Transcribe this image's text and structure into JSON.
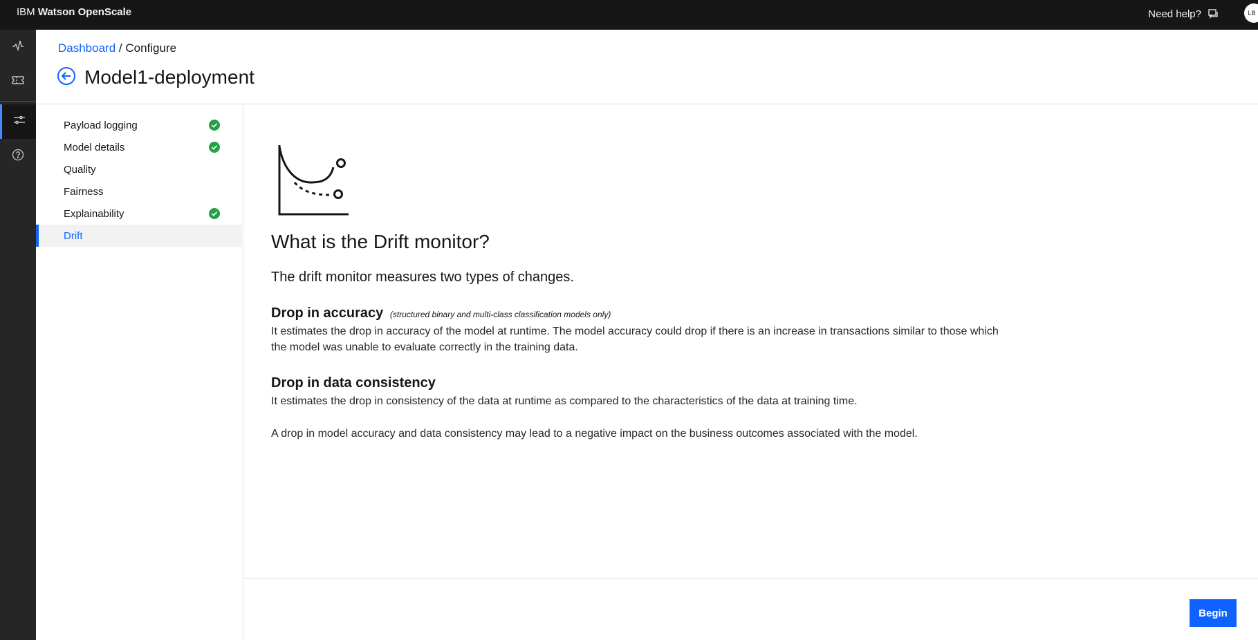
{
  "header": {
    "brand_prefix": "IBM",
    "brand_name": "Watson OpenScale",
    "help_label": "Need help?",
    "avatar_initials": "LB"
  },
  "rail": {
    "icons": [
      "activity-icon",
      "ticket-icon",
      "settings-sliders-icon",
      "help-circle-icon"
    ],
    "active_index": 2
  },
  "breadcrumb": {
    "link": "Dashboard",
    "separator": "/",
    "current": "Configure"
  },
  "page": {
    "title": "Model1-deployment"
  },
  "sidenav": {
    "items": [
      {
        "label": "Payload logging",
        "complete": true
      },
      {
        "label": "Model details",
        "complete": true
      },
      {
        "label": "Quality",
        "complete": false
      },
      {
        "label": "Fairness",
        "complete": false
      },
      {
        "label": "Explainability",
        "complete": true
      },
      {
        "label": "Drift",
        "complete": false,
        "active": true
      }
    ]
  },
  "content": {
    "heading": "What is the Drift monitor?",
    "intro": "The drift monitor measures two types of changes.",
    "section1_title": "Drop in accuracy",
    "section1_note": "(structured binary and multi-class classification models only)",
    "section1_body": "It estimates the drop in accuracy of the model at runtime. The model accuracy could drop if there is an increase in transactions similar to those which the model was unable to evaluate correctly in the training data.",
    "section2_title": "Drop in data consistency",
    "section2_body": "It estimates the drop in consistency of the data at runtime as compared to the characteristics of the data at training time.",
    "closing": "A drop in model accuracy and data consistency may lead to a negative impact on the business outcomes associated with the model."
  },
  "footer": {
    "begin_label": "Begin"
  },
  "colors": {
    "accent": "#0f62fe",
    "check": "#24a148",
    "header_bg": "#161616",
    "rail_bg": "#262626"
  }
}
